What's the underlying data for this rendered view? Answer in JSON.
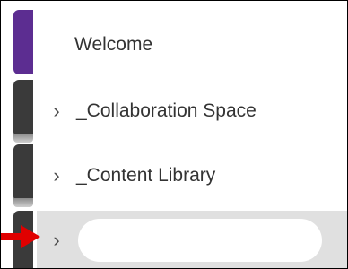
{
  "notebook": {
    "sections": [
      {
        "label": "Welcome",
        "expandable": false
      },
      {
        "label": "_Collaboration Space",
        "expandable": true
      },
      {
        "label": "_Content Library",
        "expandable": true
      },
      {
        "label": "",
        "expandable": true,
        "selected": true,
        "redacted": true
      }
    ],
    "chevron_glyph": "›"
  },
  "colors": {
    "selected_row": "#e0e0e0",
    "active_tab": "#5c2d91",
    "arrow": "#e00000"
  },
  "icons": [
    "chevron-right-icon",
    "red-arrow-annotation"
  ]
}
